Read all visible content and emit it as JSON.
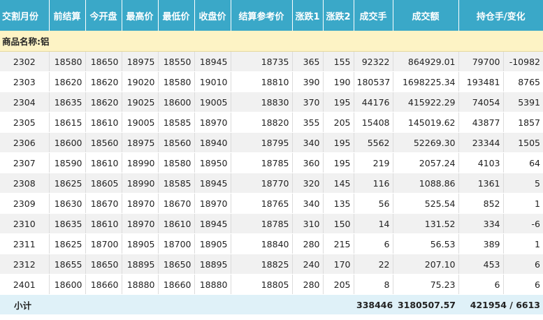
{
  "headers": [
    "交割月份",
    "前结算",
    "今开盘",
    "最高价",
    "最低价",
    "收盘价",
    "结算参考价",
    "涨跌1",
    "涨跌2",
    "成交手",
    "成交额",
    "持仓手/变化"
  ],
  "group_label": "商品名称:铝",
  "rows": [
    [
      "2302",
      "18580",
      "18650",
      "18975",
      "18550",
      "18945",
      "18735",
      "365",
      "155",
      "92322",
      "864929.01",
      "79700",
      "-10982"
    ],
    [
      "2303",
      "18620",
      "18620",
      "19020",
      "18580",
      "19010",
      "18810",
      "390",
      "190",
      "180537",
      "1698225.34",
      "193481",
      "8765"
    ],
    [
      "2304",
      "18635",
      "18620",
      "19025",
      "18600",
      "19005",
      "18830",
      "370",
      "195",
      "44176",
      "415922.29",
      "74054",
      "5391"
    ],
    [
      "2305",
      "18615",
      "18610",
      "19005",
      "18585",
      "18970",
      "18820",
      "355",
      "205",
      "15408",
      "145019.62",
      "43877",
      "1857"
    ],
    [
      "2306",
      "18600",
      "18560",
      "18975",
      "18560",
      "18940",
      "18795",
      "340",
      "195",
      "5562",
      "52269.30",
      "23344",
      "1505"
    ],
    [
      "2307",
      "18590",
      "18610",
      "18990",
      "18580",
      "18950",
      "18785",
      "360",
      "195",
      "219",
      "2057.24",
      "4103",
      "64"
    ],
    [
      "2308",
      "18625",
      "18605",
      "18990",
      "18585",
      "18945",
      "18770",
      "320",
      "145",
      "116",
      "1088.86",
      "1361",
      "5"
    ],
    [
      "2309",
      "18630",
      "18670",
      "18970",
      "18670",
      "18970",
      "18765",
      "340",
      "135",
      "56",
      "525.54",
      "852",
      "1"
    ],
    [
      "2310",
      "18635",
      "18610",
      "18970",
      "18610",
      "18945",
      "18785",
      "310",
      "150",
      "14",
      "131.52",
      "334",
      "-6"
    ],
    [
      "2311",
      "18625",
      "18700",
      "18905",
      "18700",
      "18905",
      "18840",
      "280",
      "215",
      "6",
      "56.53",
      "389",
      "1"
    ],
    [
      "2312",
      "18655",
      "18650",
      "18895",
      "18650",
      "18895",
      "18825",
      "240",
      "170",
      "22",
      "207.10",
      "453",
      "6"
    ],
    [
      "2401",
      "18600",
      "18660",
      "18880",
      "18660",
      "18880",
      "18805",
      "280",
      "205",
      "8",
      "75.23",
      "6",
      "6"
    ]
  ],
  "footer": {
    "label": "小计",
    "volume": "338446",
    "turnover": "3180507.57",
    "open_interest": "421954 / 6613"
  },
  "colors": {
    "header_bg": "#3aa8c8",
    "group_bg": "#fdf3c5",
    "footer_bg": "#dff1f8",
    "stripe_bg": "#f1f1f1"
  }
}
